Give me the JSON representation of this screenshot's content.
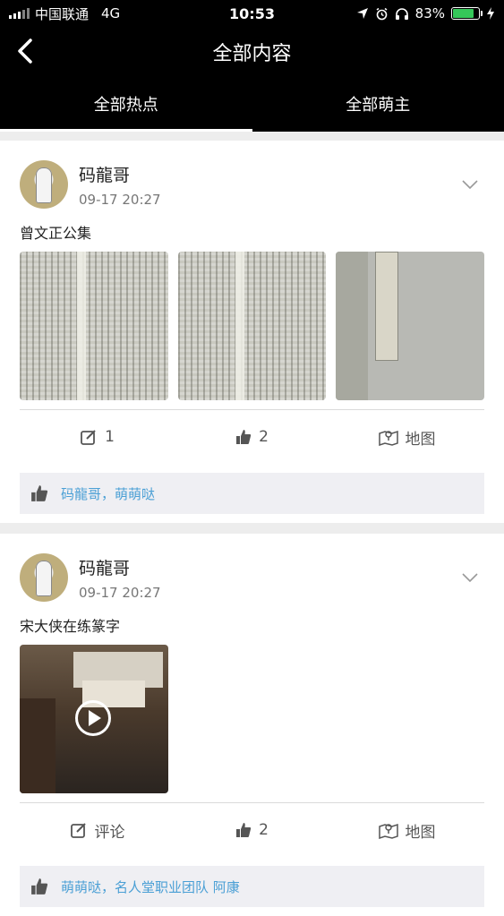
{
  "status_bar": {
    "carrier": "中国联通",
    "network": "4G",
    "time": "10:53",
    "battery": "83%",
    "battery_level": 0.83,
    "battery_color": "#35c759"
  },
  "nav": {
    "title": "全部内容",
    "back_icon": "chevron-left-icon"
  },
  "tabs": [
    {
      "label": "全部热点",
      "active": true
    },
    {
      "label": "全部萌主",
      "active": false
    }
  ],
  "posts": [
    {
      "username": "码龍哥",
      "time": "09-17 20:27",
      "text": "曾文正公集",
      "media": "images",
      "comment_label": "1",
      "like_count": "2",
      "map_label": "地图",
      "liked_by": "码龍哥，萌萌哒"
    },
    {
      "username": "码龍哥",
      "time": "09-17 20:27",
      "text": "宋大侠在练篆字",
      "media": "video",
      "comment_label": "评论",
      "like_count": "2",
      "map_label": "地图",
      "liked_by": "萌萌哒，名人堂职业团队 阿康"
    }
  ],
  "colors": {
    "link": "#4a9fd5",
    "header_bg": "#000000"
  }
}
